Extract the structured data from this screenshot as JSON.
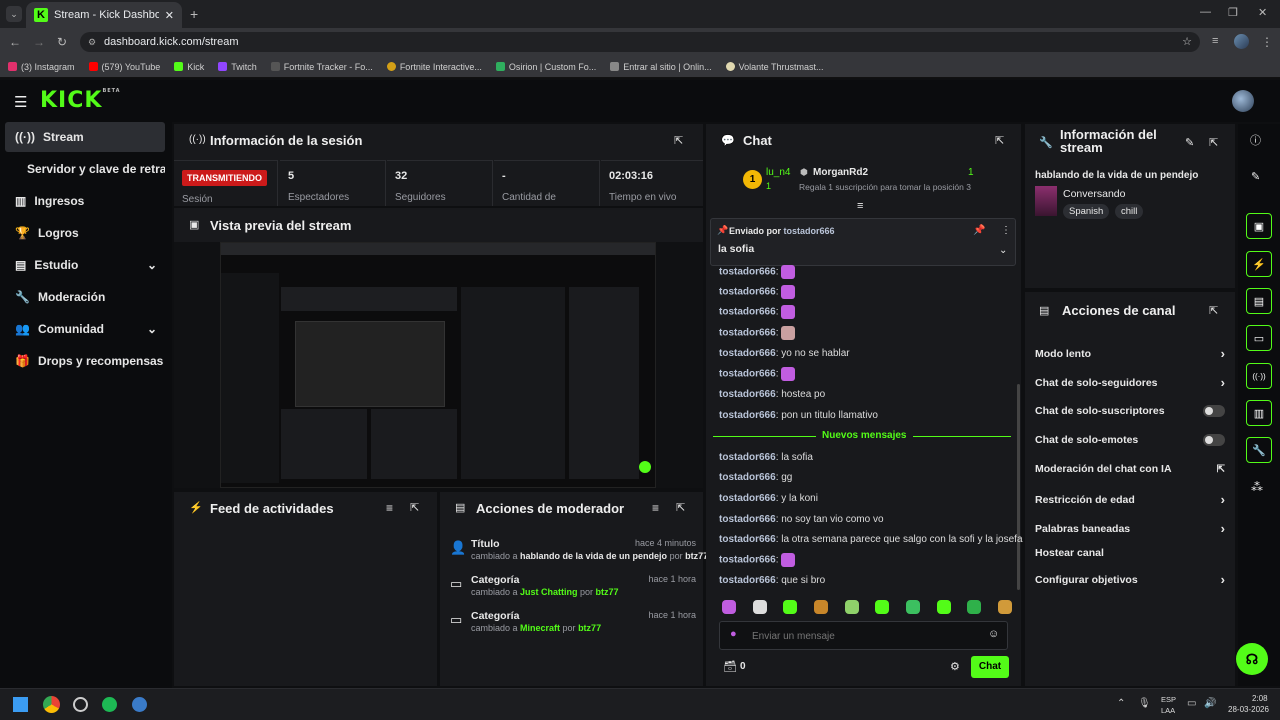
{
  "browser": {
    "tab_title": "Stream - Kick Dashboard",
    "url": "dashboard.kick.com/stream",
    "bookmarks": [
      "(3) Instagram",
      "(579) YouTube",
      "Kick",
      "Twitch",
      "Fortnite Tracker - Fo...",
      "Fortnite Interactive...",
      "Osirion | Custom Fo...",
      "Entrar al sitio | Onlin...",
      "Volante Thrustmast..."
    ]
  },
  "header": {
    "logo": "KICK",
    "logo_badge": "BETA"
  },
  "sidebar": {
    "items": [
      {
        "label": "Stream"
      },
      {
        "label": "Servidor y clave de retransm"
      },
      {
        "label": "Ingresos"
      },
      {
        "label": "Logros"
      },
      {
        "label": "Estudio"
      },
      {
        "label": "Moderación"
      },
      {
        "label": "Comunidad"
      },
      {
        "label": "Drops y recompensas"
      }
    ]
  },
  "session": {
    "title": "Información de la sesión",
    "live_badge": "TRANSMITIENDO",
    "session_label": "Sesión",
    "stats": [
      {
        "value": "5",
        "label": "Espectadores"
      },
      {
        "value": "32",
        "label": "Seguidores"
      },
      {
        "value": "-",
        "label": "Cantidad de"
      },
      {
        "value": "02:03:16",
        "label": "Tiempo en vivo"
      }
    ]
  },
  "preview": {
    "title": "Vista previa del stream"
  },
  "feed": {
    "title": "Feed de actividades"
  },
  "modactions": {
    "title": "Acciones de moderador",
    "items": [
      {
        "title": "Título",
        "time": "hace 4 minutos",
        "prefix": "cambiado a ",
        "value": "hablando de la vida de un pendejo",
        "by": " por ",
        "user": "btz77"
      },
      {
        "title": "Categoría",
        "time": "hace 1 hora",
        "prefix": "cambiado a ",
        "value": "Just Chatting",
        "by": " por ",
        "user": "btz77"
      },
      {
        "title": "Categoría",
        "time": "hace 1 hora",
        "prefix": "cambiado a ",
        "value": "Minecraft",
        "by": " por ",
        "user": "btz77"
      }
    ]
  },
  "chat": {
    "title": "Chat",
    "leader_rank": "1",
    "leader_user": "lu_n4",
    "leader_count": "1",
    "gifter": "MorganRd2",
    "gifter_count": "1",
    "gift_text": "Regala 1 suscripción para tomar la posición 3",
    "pinned_by_label": "Enviado por ",
    "pinned_by": "tostador666",
    "pinned_msg": "la sofia",
    "messages": [
      {
        "user": "tostador666",
        "text": "",
        "emote": true
      },
      {
        "user": "tostador666",
        "text": "",
        "emote": true
      },
      {
        "user": "tostador666",
        "text": "",
        "emote": true
      },
      {
        "user": "tostador666",
        "text": "",
        "emote": true
      },
      {
        "user": "tostador666",
        "text": "yo no se hablar",
        "emote": false
      },
      {
        "user": "tostador666",
        "text": "",
        "emote": true
      },
      {
        "user": "tostador666",
        "text": "hostea po",
        "emote": false
      },
      {
        "user": "tostador666",
        "text": "pon un titulo llamativo",
        "emote": false
      }
    ],
    "new_label": "Nuevos mensajes",
    "new_messages": [
      {
        "user": "tostador666",
        "text": "la sofia",
        "emote": false
      },
      {
        "user": "tostador666",
        "text": "gg",
        "emote": false
      },
      {
        "user": "tostador666",
        "text": "y la koni",
        "emote": false
      },
      {
        "user": "tostador666",
        "text": "no soy tan vio como vo",
        "emote": false
      },
      {
        "user": "tostador666",
        "text": "la otra semana parece que salgo con la sofi y la josefa",
        "emote": false
      },
      {
        "user": "tostador666",
        "text": "",
        "emote": true
      },
      {
        "user": "tostador666",
        "text": "que si bro",
        "emote": false
      }
    ],
    "input_placeholder": "Enviar un mensaje",
    "points": "0",
    "send_label": "Chat",
    "accent": "#53fc18"
  },
  "stream_info": {
    "title": "Información del stream",
    "stream_title": "hablando de la vida de un pendejo",
    "category": "Conversando",
    "tags": [
      "Spanish",
      "chill"
    ]
  },
  "channel_actions": {
    "title": "Acciones de canal",
    "items": [
      {
        "label": "Modo lento",
        "control": "chevron"
      },
      {
        "label": "Chat de solo-seguidores",
        "control": "chevron"
      },
      {
        "label": "Chat de solo-suscriptores",
        "control": "toggle"
      },
      {
        "label": "Chat de solo-emotes",
        "control": "toggle"
      },
      {
        "label": "Moderación del chat con IA",
        "control": "external"
      },
      {
        "label": "Restricción de edad",
        "control": "chevron"
      },
      {
        "label": "Palabras baneadas",
        "control": "chevron"
      },
      {
        "label": "Hostear canal",
        "control": "none"
      },
      {
        "label": "Configurar objetivos",
        "control": "chevron"
      }
    ]
  },
  "taskbar": {
    "lang1": "ESP",
    "lang2": "LAA",
    "time": "2:08",
    "date": "28-03-2026"
  }
}
